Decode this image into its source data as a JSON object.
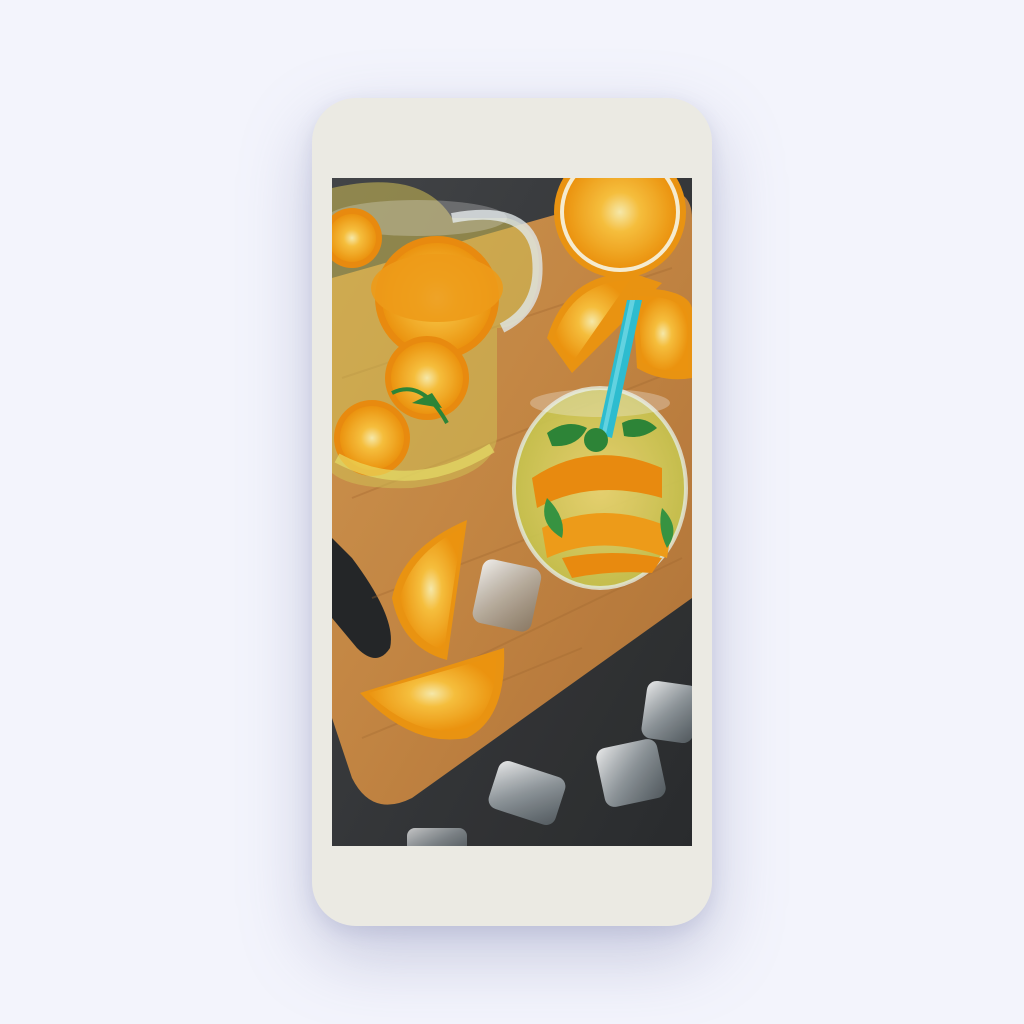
{
  "device": {
    "frame_color": "#ebeae3",
    "page_background": "#f3f4fc"
  },
  "photo": {
    "subject_icon": "photo-icon",
    "colors": {
      "table": "#3a3c3e",
      "board": "#c98a45",
      "orange_peel": "#f49a12",
      "orange_flesh": "#ffb733",
      "straw": "#2fc4d8",
      "mint": "#2f8a3a"
    }
  }
}
